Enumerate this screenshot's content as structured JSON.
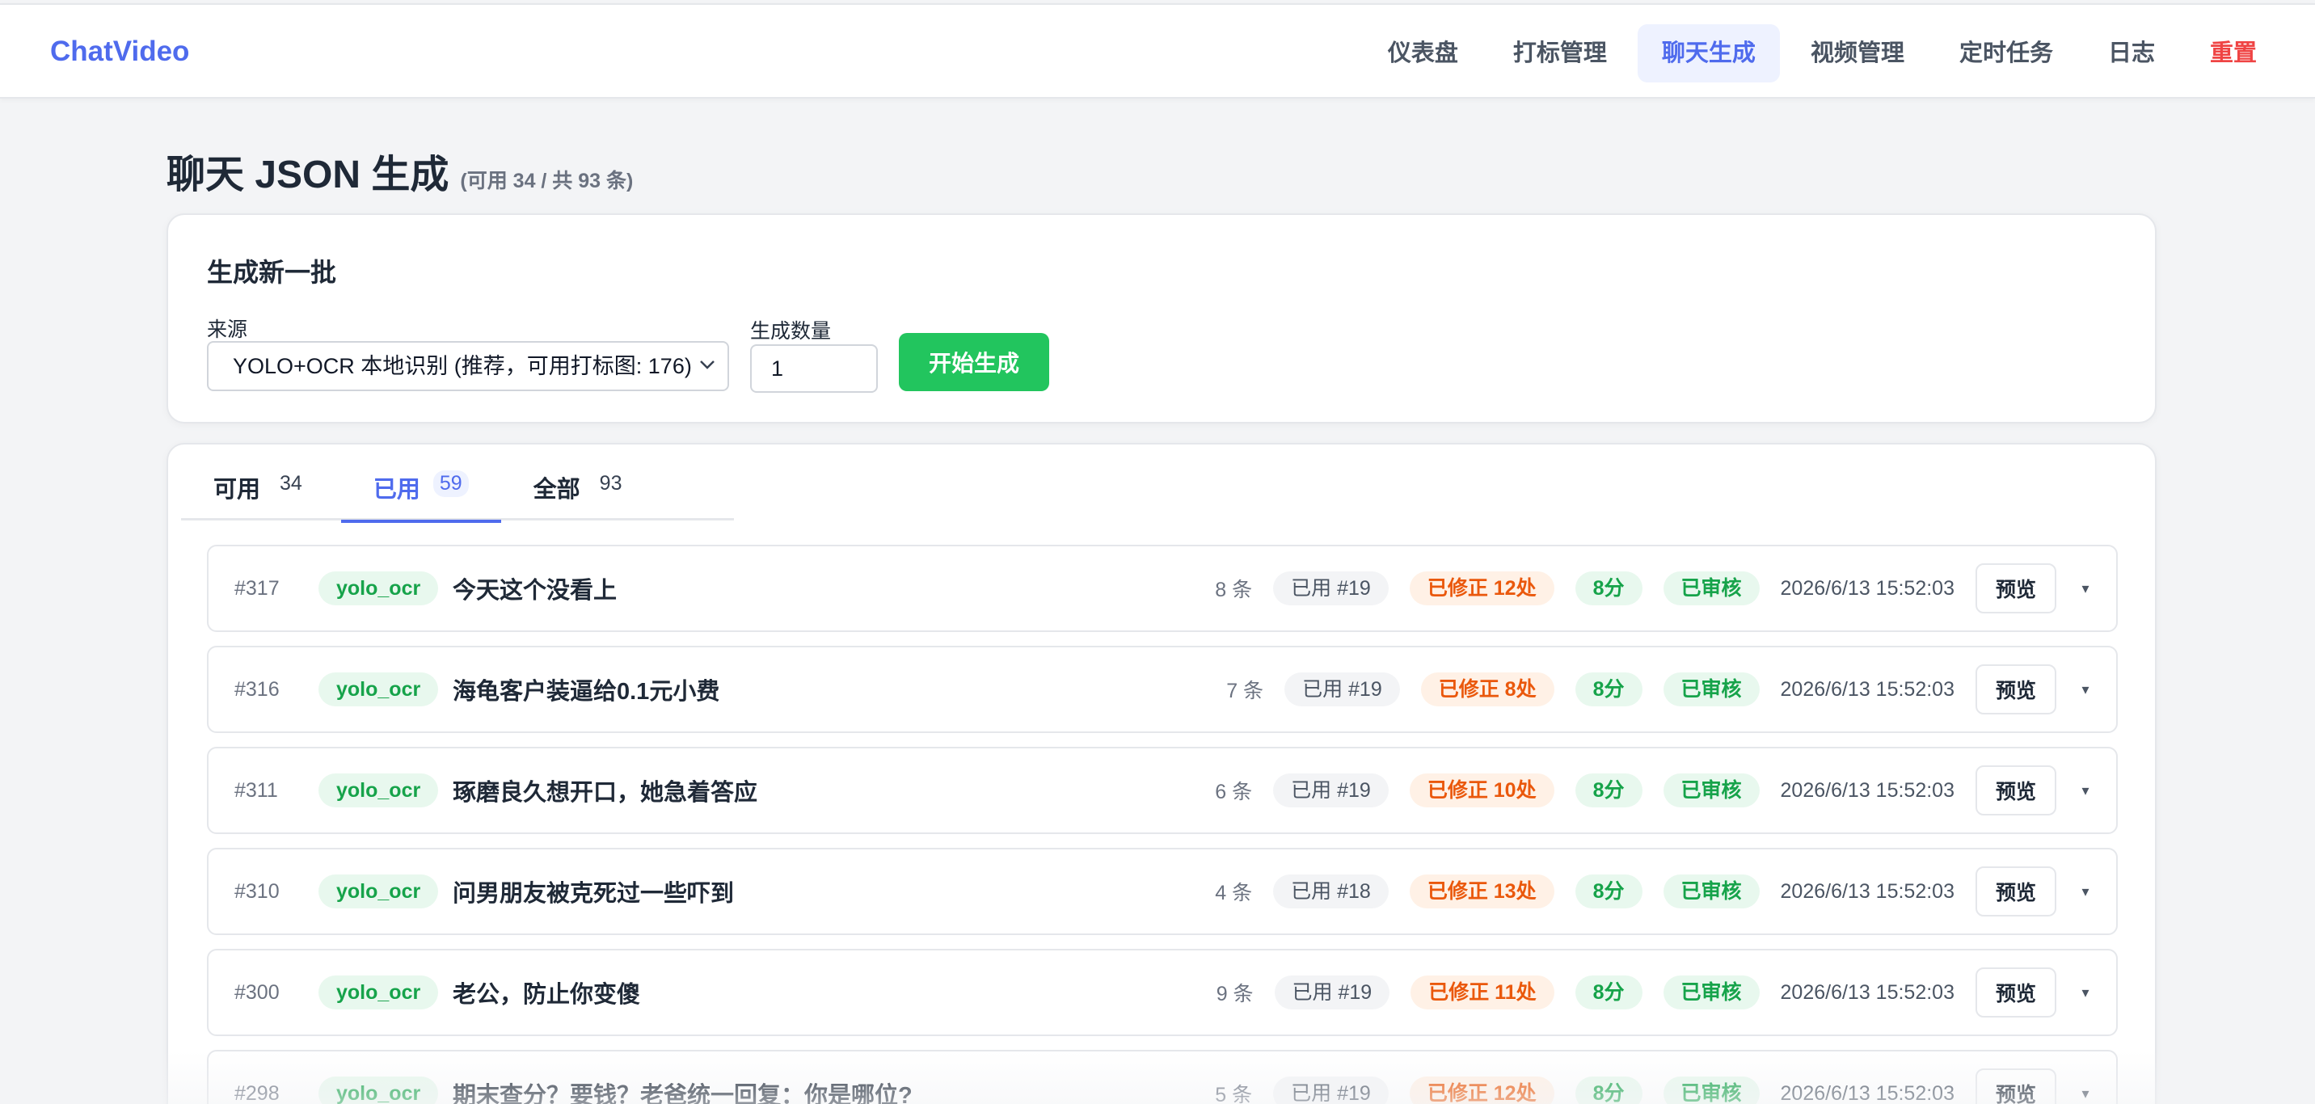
{
  "brand": "ChatVideo",
  "nav": [
    {
      "label": "仪表盘",
      "state": "normal"
    },
    {
      "label": "打标管理",
      "state": "normal"
    },
    {
      "label": "聊天生成",
      "state": "active"
    },
    {
      "label": "视频管理",
      "state": "normal"
    },
    {
      "label": "定时任务",
      "state": "normal"
    },
    {
      "label": "日志",
      "state": "normal"
    },
    {
      "label": "重置",
      "state": "danger"
    }
  ],
  "page": {
    "title": "聊天 JSON 生成",
    "subtitle": "(可用 34 / 共 93 条)"
  },
  "generate": {
    "title": "生成新一批",
    "source_label": "来源",
    "source_value": "YOLO+OCR 本地识别 (推荐，可用打标图: 176)",
    "qty_label": "生成数量",
    "qty_value": "1",
    "start_label": "开始生成"
  },
  "tabs": [
    {
      "label": "可用",
      "count": "34",
      "active": false
    },
    {
      "label": "已用",
      "count": "59",
      "active": true
    },
    {
      "label": "全部",
      "count": "93",
      "active": false
    }
  ],
  "rows": [
    {
      "id": "#317",
      "source": "yolo_ocr",
      "title": "今天这个没看上",
      "count": "8 条",
      "used": "已用 #19",
      "fixed": "已修正 12处",
      "score": "8分",
      "review": "已审核",
      "time": "2026/6/13 15:52:03",
      "preview": "预览"
    },
    {
      "id": "#316",
      "source": "yolo_ocr",
      "title": "海龟客户装逼给0.1元小费",
      "count": "7 条",
      "used": "已用 #19",
      "fixed": "已修正 8处",
      "score": "8分",
      "review": "已审核",
      "time": "2026/6/13 15:52:03",
      "preview": "预览"
    },
    {
      "id": "#311",
      "source": "yolo_ocr",
      "title": "琢磨良久想开口，她急着答应",
      "count": "6 条",
      "used": "已用 #19",
      "fixed": "已修正 10处",
      "score": "8分",
      "review": "已审核",
      "time": "2026/6/13 15:52:03",
      "preview": "预览"
    },
    {
      "id": "#310",
      "source": "yolo_ocr",
      "title": "问男朋友被克死过一些吓到",
      "count": "4 条",
      "used": "已用 #18",
      "fixed": "已修正 13处",
      "score": "8分",
      "review": "已审核",
      "time": "2026/6/13 15:52:03",
      "preview": "预览"
    },
    {
      "id": "#300",
      "source": "yolo_ocr",
      "title": "老公，防止你变傻",
      "count": "9 条",
      "used": "已用 #19",
      "fixed": "已修正 11处",
      "score": "8分",
      "review": "已审核",
      "time": "2026/6/13 15:52:03",
      "preview": "预览"
    },
    {
      "id": "#298",
      "source": "yolo_ocr",
      "title": "期末查分？要钱？老爸统一回复：你是哪位?",
      "count": "5 条",
      "used": "已用 #19",
      "fixed": "已修正 12处",
      "score": "8分",
      "review": "已审核",
      "time": "2026/6/13 15:52:03",
      "preview": "预览"
    }
  ],
  "icons": {
    "select_caret": "chevron-down-icon",
    "row_expand": "caret-down-icon"
  },
  "colors": {
    "accent": "#4f6bed",
    "primary_button": "#22c55e",
    "danger": "#ef4444",
    "fixed": "#ea580c",
    "success": "#16a34a"
  }
}
